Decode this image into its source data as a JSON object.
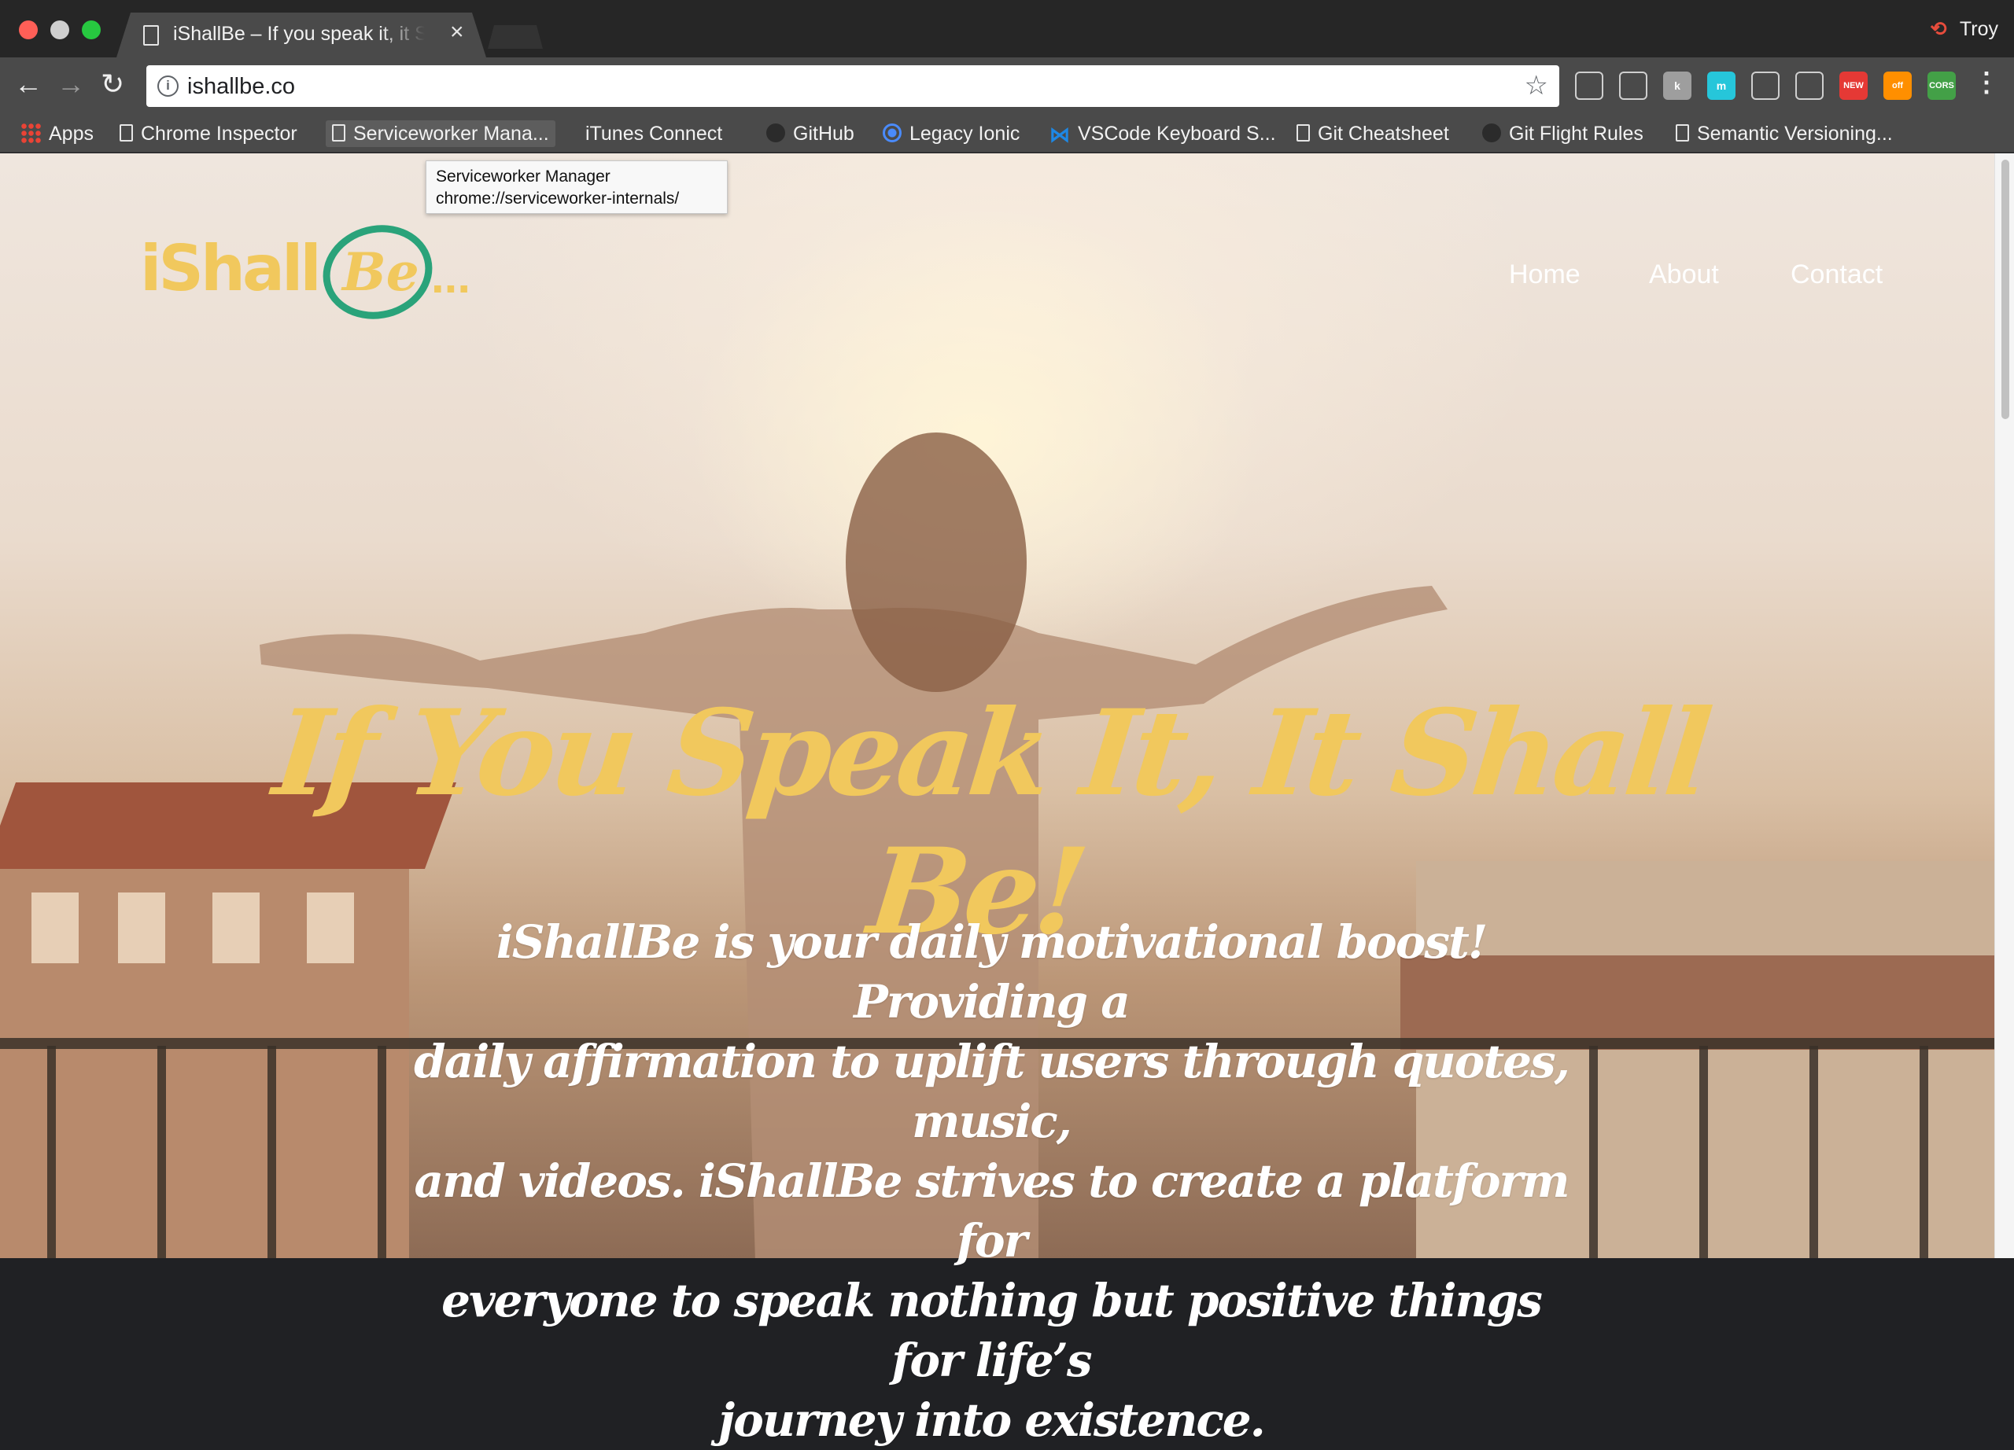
{
  "window": {
    "tab_title": "iShallBe – If you speak it, it Shall Be",
    "profile_name": "Troy"
  },
  "toolbar": {
    "url": "ishallbe.co",
    "extensions": [
      {
        "name": "evernote-icon",
        "color": "#4a4a4a",
        "label": ""
      },
      {
        "name": "cast-icon",
        "color": "#4a4a4a",
        "label": ""
      },
      {
        "name": "ext-k-icon",
        "color": "#9e9e9e",
        "label": "k"
      },
      {
        "name": "ext-m-icon",
        "color": "#26c6da",
        "label": "m"
      },
      {
        "name": "onepassword-icon",
        "color": "#4a4a4a",
        "label": ""
      },
      {
        "name": "dropbox-icon",
        "color": "#4a4a4a",
        "label": ""
      },
      {
        "name": "ext-new-icon",
        "color": "#e53935",
        "label": "NEW"
      },
      {
        "name": "ext-off-icon",
        "color": "#ff8f00",
        "label": "off"
      },
      {
        "name": "cors-icon",
        "color": "#43a047",
        "label": "CORS"
      }
    ]
  },
  "bookmarks": [
    {
      "label": "Apps",
      "icon": "apps-grid-icon"
    },
    {
      "label": "Chrome Inspector",
      "icon": "page-icon"
    },
    {
      "label": "Serviceworker Mana...",
      "icon": "page-icon"
    },
    {
      "label": "iTunes Connect",
      "icon": "apple-icon"
    },
    {
      "label": "GitHub",
      "icon": "github-icon"
    },
    {
      "label": "Legacy Ionic",
      "icon": "ionic-icon"
    },
    {
      "label": "VSCode Keyboard S...",
      "icon": "vscode-icon"
    },
    {
      "label": "Git Cheatsheet",
      "icon": "page-icon"
    },
    {
      "label": "Git Flight Rules",
      "icon": "github-icon"
    },
    {
      "label": "Semantic Versioning...",
      "icon": "page-icon"
    }
  ],
  "tooltip": {
    "title": "Serviceworker Manager",
    "url": "chrome://serviceworker-internals/"
  },
  "site": {
    "logo_text": "iShall",
    "logo_be": "Be",
    "logo_dots": "...",
    "nav": [
      "Home",
      "About",
      "Contact"
    ],
    "headline": "If You Speak It, It Shall Be!",
    "tagline_lines": [
      "iShallBe is your daily motivational boost! Providing a",
      "daily affirmation to uplift users through quotes, music,",
      "and videos.  iShallBe strives to create a platform for",
      "everyone to speak nothing but positive things for life’s",
      "journey into existence."
    ],
    "colors": {
      "accent_yellow": "#f1c85d",
      "logo_green": "#2aa37a"
    }
  }
}
